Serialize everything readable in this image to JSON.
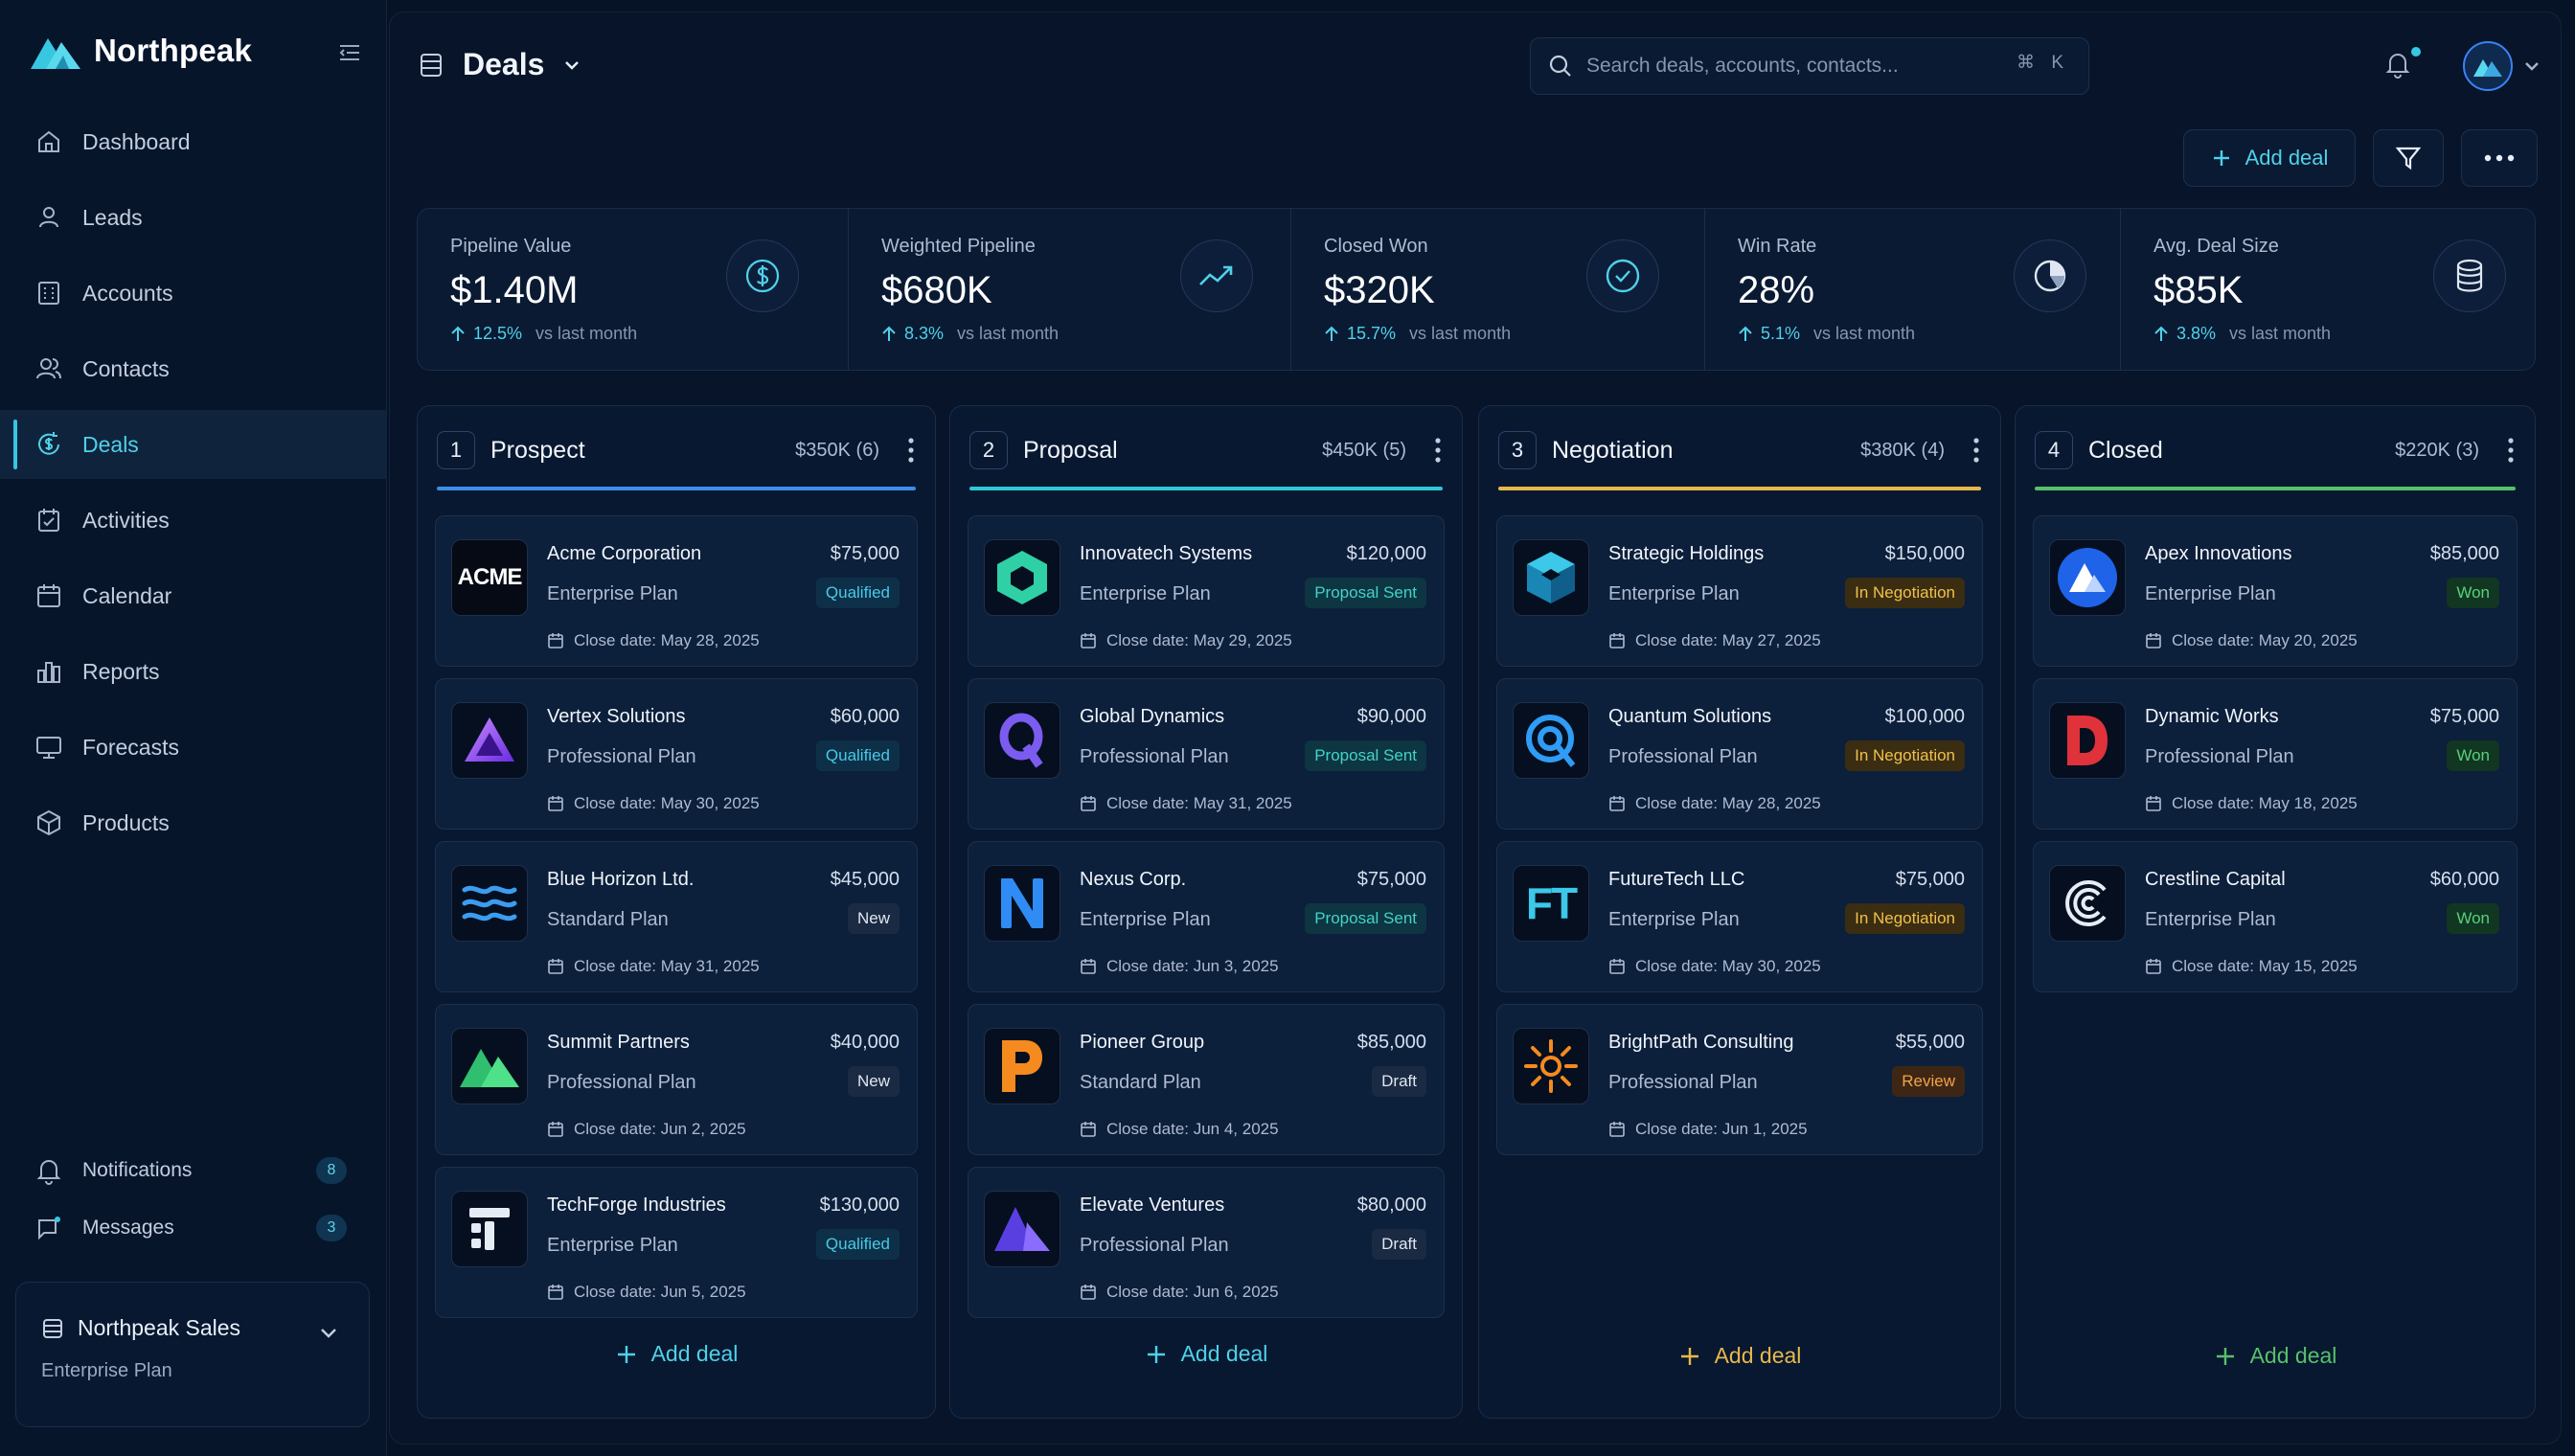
{
  "app": {
    "name": "Northpeak"
  },
  "sidebar": {
    "items": [
      {
        "label": "Dashboard",
        "icon": "home-icon"
      },
      {
        "label": "Leads",
        "icon": "user-icon"
      },
      {
        "label": "Accounts",
        "icon": "building-icon"
      },
      {
        "label": "Contacts",
        "icon": "users-icon"
      },
      {
        "label": "Deals",
        "icon": "dollar-cycle-icon",
        "active": true
      },
      {
        "label": "Activities",
        "icon": "clipboard-icon"
      },
      {
        "label": "Calendar",
        "icon": "calendar-icon"
      },
      {
        "label": "Reports",
        "icon": "bar-chart-icon"
      },
      {
        "label": "Forecasts",
        "icon": "presentation-icon"
      },
      {
        "label": "Products",
        "icon": "box-icon"
      }
    ],
    "notifications": {
      "label": "Notifications",
      "count": "8"
    },
    "messages": {
      "label": "Messages",
      "count": "3"
    },
    "workspace": {
      "name": "Northpeak Sales",
      "plan": "Enterprise Plan"
    }
  },
  "header": {
    "title": "Deals",
    "search_placeholder": "Search deals, accounts, contacts...",
    "shortcut": "⌘ K",
    "add_deal_label": "Add deal"
  },
  "stats": [
    {
      "label": "Pipeline Value",
      "value": "$1.40M",
      "change": "12.5%",
      "vs": "vs last month",
      "icon": "dollar-circle-icon"
    },
    {
      "label": "Weighted Pipeline",
      "value": "$680K",
      "change": "8.3%",
      "vs": "vs last month",
      "icon": "trend-up-icon"
    },
    {
      "label": "Closed Won",
      "value": "$320K",
      "change": "15.7%",
      "vs": "vs last month",
      "icon": "check-circle-icon"
    },
    {
      "label": "Win Rate",
      "value": "28%",
      "change": "5.1%",
      "vs": "vs last month",
      "icon": "pie-chart-icon"
    },
    {
      "label": "Avg. Deal Size",
      "value": "$85K",
      "change": "3.8%",
      "vs": "vs last month",
      "icon": "database-icon"
    }
  ],
  "colors": {
    "accent": "#38c7e0",
    "prospect": "#3b8fe8",
    "proposal": "#2ec9d6",
    "negotiation": "#e8b84a",
    "closed": "#57c06a"
  },
  "columns": [
    {
      "num": "1",
      "title": "Prospect",
      "summary": "$350K (6)",
      "add_label": "Add deal",
      "deals": [
        {
          "name": "Acme Corporation",
          "amount": "$75,000",
          "plan": "Enterprise Plan",
          "status": "Qualified",
          "date": "Close date: May 28, 2025",
          "logo": "acme-logo",
          "logo_text": "ACME"
        },
        {
          "name": "Vertex Solutions",
          "amount": "$60,000",
          "plan": "Professional Plan",
          "status": "Qualified",
          "date": "Close date: May 30, 2025",
          "logo": "vertex-logo"
        },
        {
          "name": "Blue Horizon Ltd.",
          "amount": "$45,000",
          "plan": "Standard Plan",
          "status": "New",
          "date": "Close date: May 31, 2025",
          "logo": "waves-logo"
        },
        {
          "name": "Summit Partners",
          "amount": "$40,000",
          "plan": "Professional Plan",
          "status": "New",
          "date": "Close date: Jun 2, 2025",
          "logo": "mountain-logo"
        },
        {
          "name": "TechForge Industries",
          "amount": "$130,000",
          "plan": "Enterprise Plan",
          "status": "Qualified",
          "date": "Close date: Jun 5, 2025",
          "logo": "techforge-logo"
        }
      ]
    },
    {
      "num": "2",
      "title": "Proposal",
      "summary": "$450K (5)",
      "add_label": "Add deal",
      "deals": [
        {
          "name": "Innovatech Systems",
          "amount": "$120,000",
          "plan": "Enterprise Plan",
          "status": "Proposal Sent",
          "date": "Close date: May 29, 2025",
          "logo": "hexagon-logo"
        },
        {
          "name": "Global Dynamics",
          "amount": "$90,000",
          "plan": "Professional Plan",
          "status": "Proposal Sent",
          "date": "Close date: May 31, 2025",
          "logo": "q-logo"
        },
        {
          "name": "Nexus Corp.",
          "amount": "$75,000",
          "plan": "Enterprise Plan",
          "status": "Proposal Sent",
          "date": "Close date: Jun 3, 2025",
          "logo": "n-logo"
        },
        {
          "name": "Pioneer Group",
          "amount": "$85,000",
          "plan": "Standard Plan",
          "status": "Draft",
          "date": "Close date: Jun 4, 2025",
          "logo": "p-logo"
        },
        {
          "name": "Elevate Ventures",
          "amount": "$80,000",
          "plan": "Professional Plan",
          "status": "Draft",
          "date": "Close date: Jun 6, 2025",
          "logo": "elevate-logo"
        }
      ]
    },
    {
      "num": "3",
      "title": "Negotiation",
      "summary": "$380K (4)",
      "add_label": "Add deal",
      "deals": [
        {
          "name": "Strategic Holdings",
          "amount": "$150,000",
          "plan": "Enterprise Plan",
          "status": "In Negotiation",
          "date": "Close date: May 27, 2025",
          "logo": "cube-logo"
        },
        {
          "name": "Quantum Solutions",
          "amount": "$100,000",
          "plan": "Professional Plan",
          "status": "In Negotiation",
          "date": "Close date: May 28, 2025",
          "logo": "quantum-logo"
        },
        {
          "name": "FutureTech LLC",
          "amount": "$75,000",
          "plan": "Enterprise Plan",
          "status": "In Negotiation",
          "date": "Close date: May 30, 2025",
          "logo": "ft-logo",
          "logo_text": "FT"
        },
        {
          "name": "BrightPath Consulting",
          "amount": "$55,000",
          "plan": "Professional Plan",
          "status": "Review",
          "date": "Close date: Jun 1, 2025",
          "logo": "sun-logo"
        }
      ]
    },
    {
      "num": "4",
      "title": "Closed",
      "summary": "$220K (3)",
      "add_label": "Add deal",
      "deals": [
        {
          "name": "Apex Innovations",
          "amount": "$85,000",
          "plan": "Enterprise Plan",
          "status": "Won",
          "date": "Close date: May 20, 2025",
          "logo": "apex-logo"
        },
        {
          "name": "Dynamic Works",
          "amount": "$75,000",
          "plan": "Professional Plan",
          "status": "Won",
          "date": "Close date: May 18, 2025",
          "logo": "d-logo"
        },
        {
          "name": "Crestline Capital",
          "amount": "$60,000",
          "plan": "Enterprise Plan",
          "status": "Won",
          "date": "Close date: May 15, 2025",
          "logo": "c-logo"
        }
      ]
    }
  ]
}
